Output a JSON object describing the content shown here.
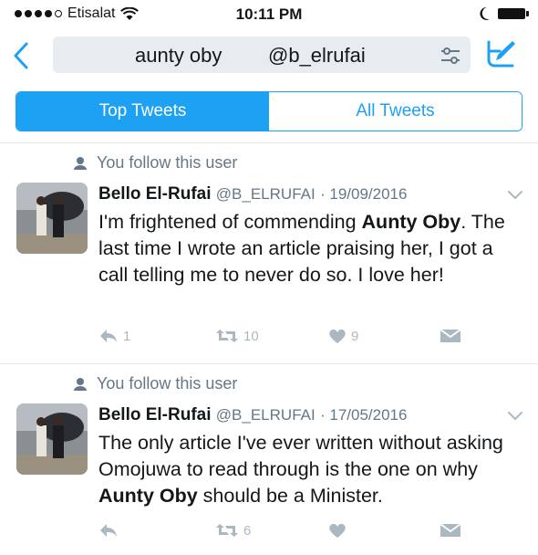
{
  "status_bar": {
    "carrier": "Etisalat",
    "time": "10:11 PM"
  },
  "search": {
    "query_1": "aunty oby",
    "query_2": "@b_elrufai"
  },
  "tabs": [
    {
      "label": "Top Tweets",
      "active": true
    },
    {
      "label": "All Tweets",
      "active": false
    }
  ],
  "tweets": [
    {
      "social_context": "You follow this user",
      "name": "Bello El-Rufai",
      "handle": "@B_ELRUFAI",
      "date": "· 19/09/2016",
      "text_1": "I'm frightened of commending ",
      "highlight_1": "Aunty Oby",
      "text_2": ". The last time I wrote an article praising her, I got a call telling me to never do so. I love her!",
      "highlight_2": "",
      "text_3": "",
      "reply_count": "1",
      "retweet_count": "10",
      "like_count": "9"
    },
    {
      "social_context": "You follow this user",
      "name": "Bello El-Rufai",
      "handle": "@B_ELRUFAI",
      "date": "· 17/05/2016",
      "text_1": "The only article I've ever written without asking Omojuwa to read through is the one on why ",
      "highlight_1": "Aunty Oby",
      "text_2": " should be a Minister.",
      "highlight_2": "",
      "text_3": "",
      "reply_count": "",
      "retweet_count": "6",
      "like_count": ""
    }
  ],
  "colors": {
    "accent": "#1da1f2",
    "muted": "#657786",
    "action": "#aab8c2"
  }
}
